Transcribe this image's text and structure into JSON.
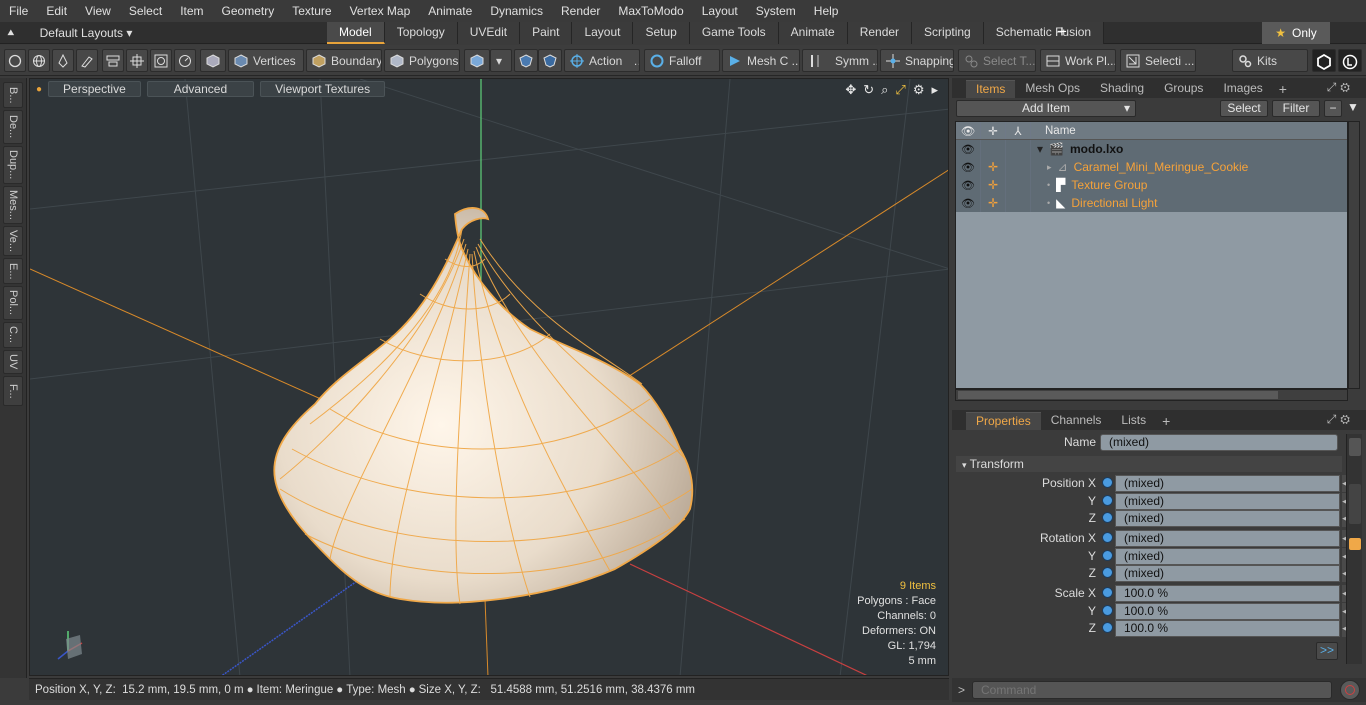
{
  "menu": [
    "File",
    "Edit",
    "View",
    "Select",
    "Item",
    "Geometry",
    "Texture",
    "Vertex Map",
    "Animate",
    "Dynamics",
    "Render",
    "MaxToModo",
    "Layout",
    "System",
    "Help"
  ],
  "layout_selector": "Default Layouts",
  "tabs": [
    "Model",
    "Topology",
    "UVEdit",
    "Paint",
    "Layout",
    "Setup",
    "Game Tools",
    "Animate",
    "Render",
    "Scripting",
    "Schematic Fusion"
  ],
  "active_tab": "Model",
  "only_label": "Only",
  "toolbar": {
    "vertices": "Vertices",
    "boundary": "Boundary",
    "polygons": "Polygons",
    "action": "Action",
    "falloff": "Falloff",
    "mesh_c": "Mesh C ...",
    "symm": "Symm ...",
    "snapping": "Snapping",
    "select_t": "Select T...",
    "work_pl": "Work Pl...",
    "selecti": "Selecti ...",
    "kits": "Kits"
  },
  "left_tabs": [
    "B...",
    "De...",
    "Dup...",
    "Mes...",
    "Ve...",
    "E...",
    "Pol...",
    "C...",
    "UV",
    "F..."
  ],
  "viewport": {
    "perspective": "Perspective",
    "advanced": "Advanced",
    "viewport_textures": "Viewport Textures",
    "info": {
      "items": "9 Items",
      "polygons": "Polygons : Face",
      "channels": "Channels: 0",
      "deformers": "Deformers: ON",
      "gl": "GL: 1,794",
      "scale": "5 mm"
    }
  },
  "status": {
    "position_label": "Position X, Y, Z:",
    "position_value": "15.2 mm, 19.5 mm, 0 m",
    "item_label": "Item:",
    "item_value": "Meringue",
    "type_label": "Type:",
    "type_value": "Mesh",
    "size_label": "Size X, Y, Z:",
    "size_value": "51.4588 mm, 51.2516 mm, 38.4376 mm"
  },
  "items_panel": {
    "tabs": [
      "Items",
      "Mesh Ops",
      "Shading",
      "Groups",
      "Images"
    ],
    "add_item": "Add Item",
    "select": "Select",
    "filter": "Filter",
    "column_name": "Name",
    "rows": [
      "modo.lxo",
      "Caramel_Mini_Meringue_Cookie",
      "Texture Group",
      "Directional Light"
    ]
  },
  "props_panel": {
    "tabs": [
      "Properties",
      "Channels",
      "Lists"
    ],
    "name_label": "Name",
    "name_value": "(mixed)",
    "section": "Transform",
    "rows": [
      {
        "label": "Position X",
        "value": "(mixed)"
      },
      {
        "label": "Y",
        "value": "(mixed)"
      },
      {
        "label": "Z",
        "value": "(mixed)"
      },
      {
        "label": "Rotation X",
        "value": "(mixed)"
      },
      {
        "label": "Y",
        "value": "(mixed)"
      },
      {
        "label": "Z",
        "value": "(mixed)"
      },
      {
        "label": "Scale X",
        "value": "100.0 %"
      },
      {
        "label": "Y",
        "value": "100.0 %"
      },
      {
        "label": "Z",
        "value": "100.0 %"
      }
    ],
    "more": ">>"
  },
  "command_placeholder": "Command",
  "colors": {
    "accent": "#e8a33a",
    "wire": "#f0a848",
    "viewport_bg": "#2e3438"
  }
}
